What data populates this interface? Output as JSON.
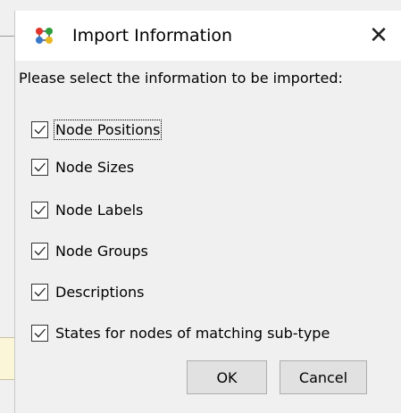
{
  "dialog": {
    "title": "Import Information",
    "app_icon": "node-graph-icon",
    "close_glyph": "✕",
    "prompt": "Please select the information to be imported:",
    "options": [
      {
        "label": "Node Positions",
        "checked": true,
        "focused": true
      },
      {
        "label": "Node Sizes",
        "checked": true
      },
      {
        "label": "Node Labels",
        "checked": true
      },
      {
        "label": "Node Groups",
        "checked": true
      },
      {
        "label": "Descriptions",
        "checked": true
      },
      {
        "label": "States for nodes of matching sub-type",
        "checked": true
      }
    ],
    "ok_label": "OK",
    "cancel_label": "Cancel"
  },
  "colors": {
    "icon_red": "#e0342c",
    "icon_green": "#2e9e3c",
    "icon_blue": "#3a78c8",
    "icon_yellow": "#e8b820"
  }
}
